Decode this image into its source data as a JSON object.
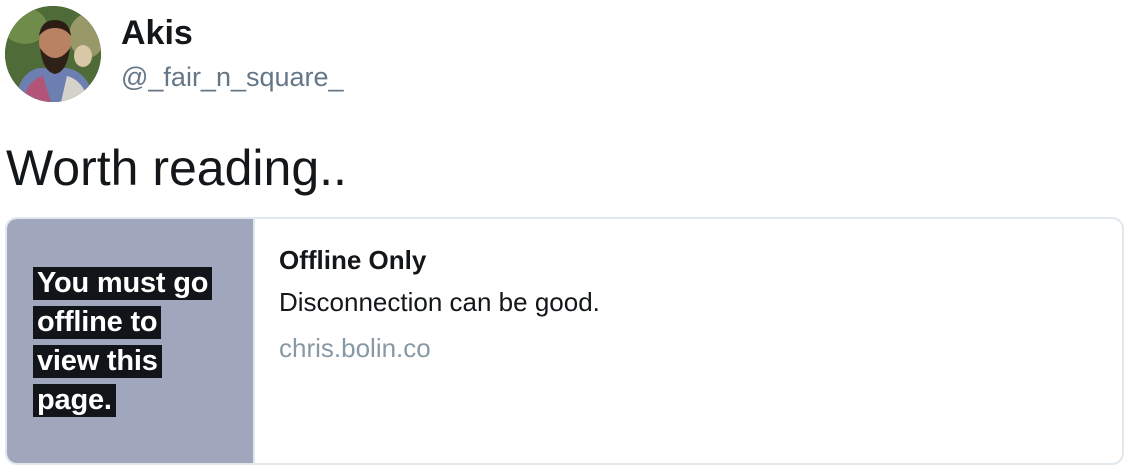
{
  "author": {
    "display_name": "Akis",
    "handle": "@_fair_n_square_",
    "avatar_icon": "profile-photo"
  },
  "tweet": {
    "text": "Worth reading.."
  },
  "card": {
    "image_text_lines": [
      "You must go",
      "offline to",
      "view this",
      "page."
    ],
    "title": "Offline Only",
    "description": "Disconnection can be good.",
    "domain": "chris.bolin.co"
  },
  "colors": {
    "text_primary": "#14171a",
    "text_secondary": "#657786",
    "domain_text": "#8899a6",
    "card_border": "#e1e8ed",
    "card_image_bg": "#a0a7bd"
  }
}
